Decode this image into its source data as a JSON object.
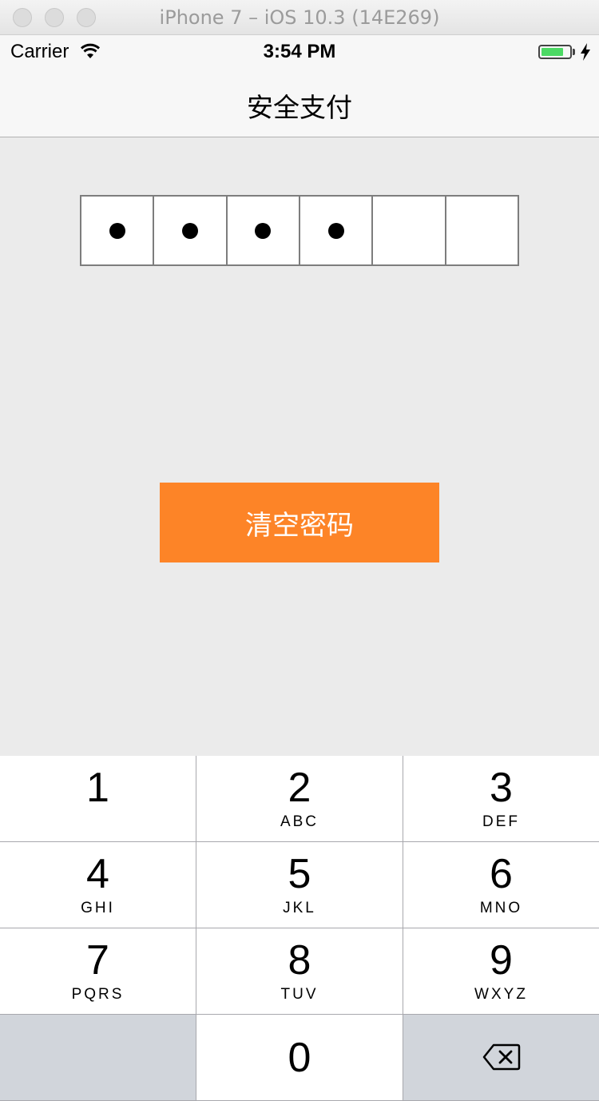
{
  "window": {
    "title": "iPhone 7 – iOS 10.3 (14E269)"
  },
  "status_bar": {
    "carrier": "Carrier",
    "time": "3:54 PM",
    "battery_level": 0.8
  },
  "nav": {
    "title": "安全支付"
  },
  "password": {
    "length": 6,
    "filled": 4
  },
  "clear_button": {
    "label": "清空密码",
    "color": "#fd8427"
  },
  "keypad": {
    "keys": [
      {
        "num": "1",
        "letters": ""
      },
      {
        "num": "2",
        "letters": "ABC"
      },
      {
        "num": "3",
        "letters": "DEF"
      },
      {
        "num": "4",
        "letters": "GHI"
      },
      {
        "num": "5",
        "letters": "JKL"
      },
      {
        "num": "6",
        "letters": "MNO"
      },
      {
        "num": "7",
        "letters": "PQRS"
      },
      {
        "num": "8",
        "letters": "TUV"
      },
      {
        "num": "9",
        "letters": "WXYZ"
      }
    ],
    "zero": "0"
  }
}
